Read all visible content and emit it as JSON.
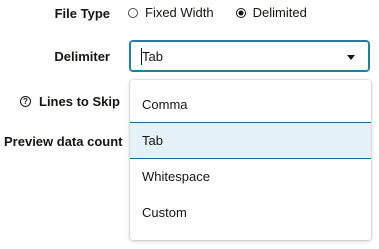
{
  "file_type": {
    "label": "File Type",
    "options": [
      "Fixed Width",
      "Delimited"
    ],
    "selected": "Delimited"
  },
  "delimiter": {
    "label": "Delimiter",
    "value": "Tab",
    "options": [
      "Comma",
      "Tab",
      "Whitespace",
      "Custom"
    ],
    "highlighted": "Tab"
  },
  "lines_to_skip": {
    "label": "Lines to Skip"
  },
  "preview_data_count": {
    "label": "Preview data count"
  },
  "colors": {
    "focus_border": "#227e9e",
    "selected_option_bg": "#e4f1f7",
    "selected_option_border": "#1b6b85",
    "text": "#161513"
  }
}
